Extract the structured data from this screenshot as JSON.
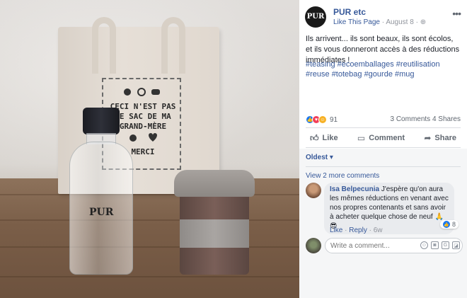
{
  "post": {
    "page_name": "PUR etc",
    "like_page": "Like This Page",
    "date": "August 8",
    "separator": "·",
    "more_icon": "ellipsis-icon",
    "avatar_text": "PUR",
    "text": "Ils arrivent... ils sont beaux, ils sont écolos, et ils vous donneront accès à des réductions immédiates !",
    "hashtags": "#teasing #ecoemballages #reutilisation #reuse #totebag #gourde #mug"
  },
  "photo": {
    "bag_lines": [
      "CECI N'EST PAS",
      "LE SAC DE MA",
      "GRAND-MÈRE",
      "MERCI"
    ],
    "bottle_logo": "PUR"
  },
  "reactions": {
    "count": "91",
    "comments": "3 Comments",
    "shares": "4 Shares"
  },
  "actions": {
    "like": "Like",
    "comment": "Comment",
    "share": "Share"
  },
  "comments": {
    "sort": "Oldest ▾",
    "view_more": "View 2 more comments",
    "items": [
      {
        "author": "Isa Belpecunia",
        "text": "J'espère qu'on aura les mêmes réductions en venant avec nos propres contenants et sans avoir à acheter quelque chose de neuf 🙏😎",
        "reaction_count": "8",
        "like": "Like",
        "reply": "Reply",
        "time": "6w"
      }
    ],
    "write_placeholder": "Write a comment..."
  }
}
